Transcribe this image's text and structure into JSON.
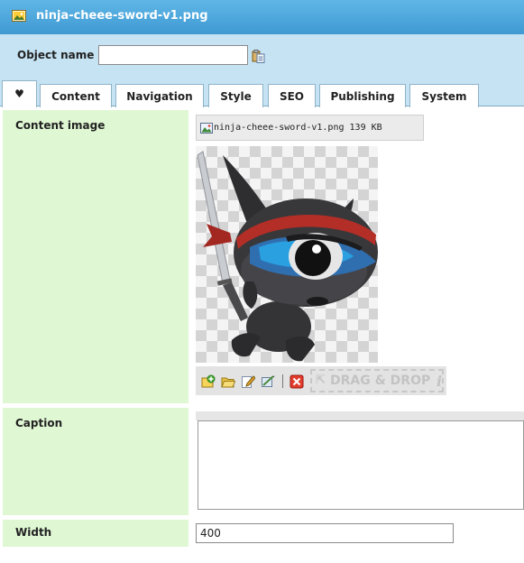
{
  "window": {
    "title": "ninja-cheee-sword-v1.png"
  },
  "object_name": {
    "label": "Object name",
    "value": "",
    "placeholder": ""
  },
  "tabs": [
    {
      "label": "♥",
      "active": true
    },
    {
      "label": "Content",
      "active": false
    },
    {
      "label": "Navigation",
      "active": false
    },
    {
      "label": "Style",
      "active": false
    },
    {
      "label": "SEO",
      "active": false
    },
    {
      "label": "Publishing",
      "active": false
    },
    {
      "label": "System",
      "active": false
    }
  ],
  "fields": {
    "content_image": {
      "label": "Content image",
      "filename": "ninja-cheee-sword-v1.png",
      "filesize": "139 KB",
      "drag_drop_label": "DRAG & DROP",
      "drag_arrow": "⇱",
      "info_glyph": "i"
    },
    "caption": {
      "label": "Caption",
      "value": ""
    },
    "width": {
      "label": "Width",
      "value": "400"
    }
  },
  "icons": {
    "title": "image-file-icon",
    "object_picker": "copy-paste-icon",
    "toolbar": [
      "add-image-icon",
      "open-folder-icon",
      "edit-icon",
      "crop-icon",
      "delete-icon"
    ]
  },
  "colors": {
    "title_bar": "#4aa8dd",
    "object_bar": "#c5e3f3",
    "label_cell": "#dff7d3",
    "tab_border": "#8fb3c9"
  }
}
